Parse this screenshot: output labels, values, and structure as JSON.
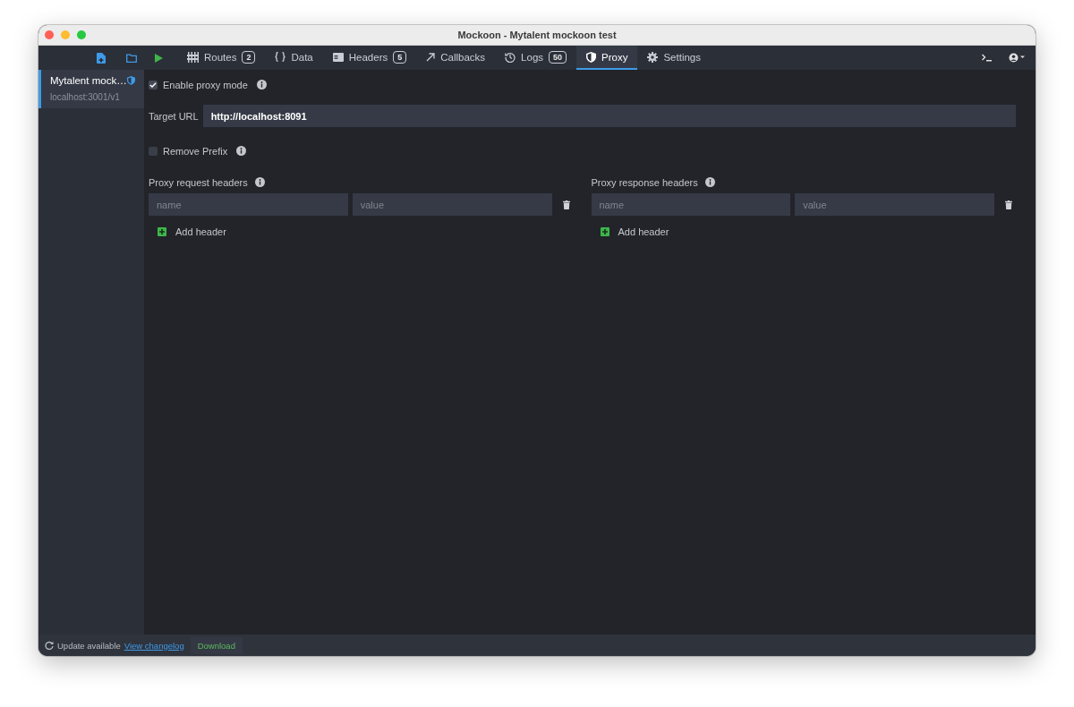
{
  "window": {
    "title": "Mockoon - Mytalent mockoon test"
  },
  "tabs": [
    {
      "kind": "routes",
      "label": "Routes",
      "badge": "2",
      "selected": false
    },
    {
      "kind": "data",
      "label": "Data",
      "selected": false
    },
    {
      "kind": "headers",
      "label": "Headers",
      "badge": "5",
      "selected": false
    },
    {
      "kind": "callbacks",
      "label": "Callbacks",
      "selected": false
    },
    {
      "kind": "logs",
      "label": "Logs",
      "badge": "50",
      "selected": false
    },
    {
      "kind": "proxy",
      "label": "Proxy",
      "selected": true
    },
    {
      "kind": "settings",
      "label": "Settings",
      "selected": false
    }
  ],
  "sidebar": {
    "items": [
      {
        "name": "Mytalent mock…",
        "address": "localhost:3001/v1",
        "selected": true
      }
    ]
  },
  "proxy": {
    "enable": {
      "label": "Enable proxy mode",
      "checked": true
    },
    "target": {
      "label": "Target URL",
      "value": "http://localhost:8091"
    },
    "remove_prefix": {
      "label": "Remove Prefix",
      "checked": false
    },
    "header_groups": [
      {
        "title": "Proxy request headers",
        "name_placeholder": "name",
        "value_placeholder": "value",
        "add": "Add header"
      },
      {
        "title": "Proxy response headers",
        "name_placeholder": "name",
        "value_placeholder": "value",
        "add": "Add header"
      }
    ]
  },
  "status_bar": {
    "text": "Update available",
    "link": "View changelog",
    "button": "Download"
  }
}
